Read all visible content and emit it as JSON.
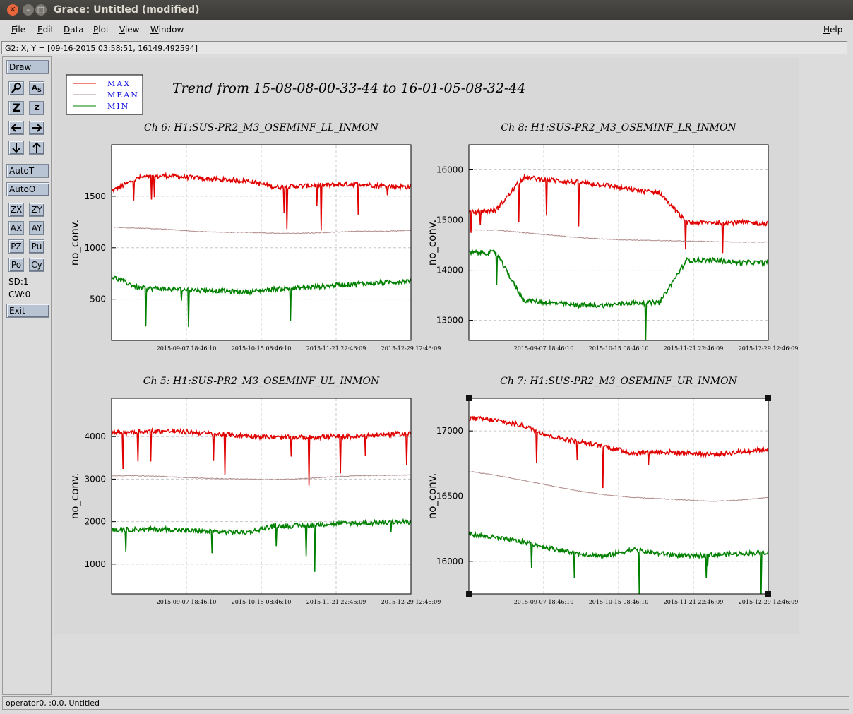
{
  "window": {
    "title": "Grace: Untitled (modified)"
  },
  "menubar": {
    "items": [
      "File",
      "Edit",
      "Data",
      "Plot",
      "View",
      "Window"
    ],
    "help": "Help"
  },
  "locator": {
    "text": "G2: X, Y = [09-16-2015 03:58:51, 16149.492594]"
  },
  "toolbar": {
    "draw": "Draw",
    "autot": "AutoT",
    "autoo": "AutoO",
    "pairs": [
      [
        "ZX",
        "ZY"
      ],
      [
        "AX",
        "AY"
      ],
      [
        "PZ",
        "Pu"
      ],
      [
        "Po",
        "Cy"
      ]
    ],
    "sd": "SD:1",
    "cw": "CW:0",
    "exit": "Exit"
  },
  "status": {
    "text": "operator0, :0.0, Untitled"
  },
  "figure": {
    "title": "Trend from 15-08-08-00-33-44 to 16-01-05-08-32-44",
    "legend": [
      {
        "label": "MAX",
        "color": "#e00000"
      },
      {
        "label": "MEAN",
        "color": "#b08a8a"
      },
      {
        "label": "MIN",
        "color": "#008000"
      }
    ]
  },
  "chart_data": [
    {
      "type": "line",
      "title": "Ch 6: H1:SUS-PR2_M3_OSEMINF_LL_INMON",
      "ylabel": "no_conv.",
      "xticks": [
        "2015-09-07 18:46:10",
        "2015-10-15 08:46:10",
        "2015-11-21 22:46:09",
        "2015-12-29 12:46:09"
      ],
      "yticks": [
        500,
        1000,
        1500
      ],
      "ylim": [
        100,
        2000
      ],
      "series": [
        {
          "name": "MAX",
          "color": "#e00000",
          "values": [
            1550,
            1680,
            1700,
            1680,
            1660,
            1650,
            1590,
            1600,
            1610,
            1620,
            1600,
            1590
          ]
        },
        {
          "name": "MEAN",
          "color": "#b08a8a",
          "values": [
            1200,
            1190,
            1180,
            1160,
            1150,
            1150,
            1140,
            1140,
            1150,
            1160,
            1160,
            1170
          ]
        },
        {
          "name": "MIN",
          "color": "#008000",
          "values": [
            720,
            610,
            600,
            590,
            580,
            570,
            600,
            610,
            630,
            650,
            660,
            680
          ]
        }
      ]
    },
    {
      "type": "line",
      "title": "Ch 8: H1:SUS-PR2_M3_OSEMINF_LR_INMON",
      "ylabel": "no_conv.",
      "xticks": [
        "2015-09-07 18:46:10",
        "2015-10-15 08:46:10",
        "2015-11-21 22:46:09",
        "2015-12-29 12:46:09"
      ],
      "yticks": [
        13000,
        14000,
        15000,
        16000
      ],
      "ylim": [
        12600,
        16500
      ],
      "series": [
        {
          "name": "MAX",
          "color": "#e00000",
          "values": [
            15150,
            15200,
            15850,
            15800,
            15750,
            15700,
            15600,
            15550,
            14950,
            14950,
            14950,
            14930
          ]
        },
        {
          "name": "MEAN",
          "color": "#b08a8a",
          "values": [
            14800,
            14800,
            14750,
            14700,
            14650,
            14620,
            14600,
            14590,
            14580,
            14570,
            14560,
            14560
          ]
        },
        {
          "name": "MIN",
          "color": "#008000",
          "values": [
            14350,
            14350,
            13400,
            13350,
            13300,
            13300,
            13350,
            13350,
            14200,
            14200,
            14150,
            14150
          ]
        }
      ]
    },
    {
      "type": "line",
      "title": "Ch 5: H1:SUS-PR2_M3_OSEMINF_UL_INMON",
      "ylabel": "no_conv.",
      "xticks": [
        "2015-09-07 18:46:10",
        "2015-10-15 08:46:10",
        "2015-11-21 22:46:09",
        "2015-12-29 12:46:09"
      ],
      "yticks": [
        1000,
        2000,
        3000,
        4000
      ],
      "ylim": [
        300,
        4900
      ],
      "series": [
        {
          "name": "MAX",
          "color": "#e00000",
          "values": [
            4100,
            4120,
            4130,
            4100,
            4050,
            4020,
            3980,
            3980,
            4000,
            4000,
            4050,
            4070
          ]
        },
        {
          "name": "MEAN",
          "color": "#b08a8a",
          "values": [
            3080,
            3080,
            3060,
            3030,
            3010,
            3000,
            2990,
            3010,
            3050,
            3080,
            3090,
            3100
          ]
        },
        {
          "name": "MIN",
          "color": "#008000",
          "values": [
            1800,
            1820,
            1820,
            1780,
            1760,
            1750,
            1900,
            1900,
            1950,
            1960,
            1980,
            1990
          ]
        }
      ]
    },
    {
      "type": "line",
      "title": "Ch 7: H1:SUS-PR2_M3_OSEMINF_UR_INMON",
      "ylabel": "no_conv.",
      "xticks": [
        "2015-09-07 18:46:10",
        "2015-10-15 08:46:10",
        "2015-11-21 22:46:09",
        "2015-12-29 12:46:09"
      ],
      "yticks": [
        16000,
        16500,
        17000
      ],
      "ylim": [
        15750,
        17250
      ],
      "series": [
        {
          "name": "MAX",
          "color": "#e00000",
          "values": [
            17100,
            17080,
            17040,
            16960,
            16920,
            16880,
            16830,
            16840,
            16830,
            16820,
            16840,
            16860
          ]
        },
        {
          "name": "MEAN",
          "color": "#b08a8a",
          "values": [
            16690,
            16660,
            16620,
            16580,
            16540,
            16510,
            16490,
            16480,
            16470,
            16460,
            16470,
            16490
          ]
        },
        {
          "name": "MIN",
          "color": "#008000",
          "values": [
            16210,
            16180,
            16150,
            16100,
            16060,
            16040,
            16090,
            16060,
            16040,
            16050,
            16060,
            16070
          ]
        }
      ]
    }
  ]
}
